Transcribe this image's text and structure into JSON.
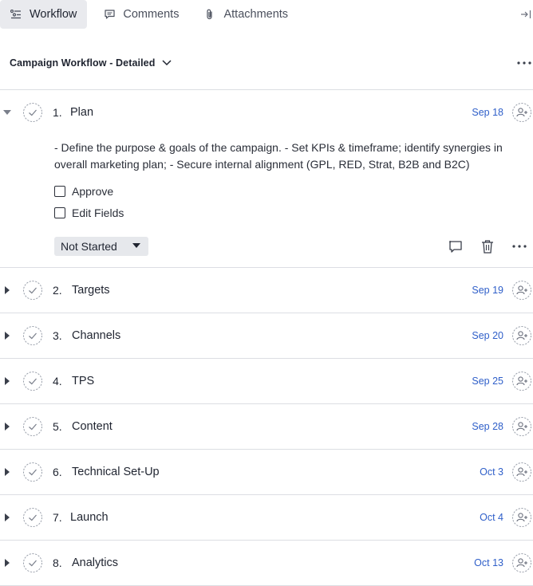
{
  "tabs": [
    {
      "label": "Workflow",
      "icon": "workflow-icon",
      "active": true
    },
    {
      "label": "Comments",
      "icon": "comment-icon",
      "active": false
    },
    {
      "label": "Attachments",
      "icon": "paperclip-icon",
      "active": false
    }
  ],
  "workflow": {
    "title": "Campaign Workflow - Detailed"
  },
  "steps": [
    {
      "num": "1.",
      "name": "Plan",
      "date": "Sep 18",
      "expanded": true
    },
    {
      "num": "2.",
      "name": "Targets",
      "date": "Sep 19"
    },
    {
      "num": "3.",
      "name": "Channels",
      "date": "Sep 20"
    },
    {
      "num": "4.",
      "name": "TPS",
      "date": "Sep 25"
    },
    {
      "num": "5.",
      "name": "Content",
      "date": "Sep 28"
    },
    {
      "num": "6.",
      "name": "Technical Set-Up",
      "date": "Oct 3"
    },
    {
      "num": "7.",
      "name": "Launch",
      "date": "Oct 4"
    },
    {
      "num": "8.",
      "name": "Analytics",
      "date": "Oct 13"
    }
  ],
  "expanded_step": {
    "description_line1": "- Define the purpose & goals of the campaign. - Set KPIs & timeframe; identify synergies in",
    "description_line2": "overall marketing plan; - Secure internal alignment (GPL, RED, Strat, B2B and B2C)",
    "checklist": [
      {
        "label": "Approve",
        "checked": false
      },
      {
        "label": "Edit Fields",
        "checked": false
      }
    ],
    "status": "Not Started"
  },
  "colors": {
    "accent_date": "#2f5fc9",
    "divider": "#dcdee3",
    "tab_active_bg": "#e9eaee",
    "status_bg": "#e6e8ec"
  }
}
